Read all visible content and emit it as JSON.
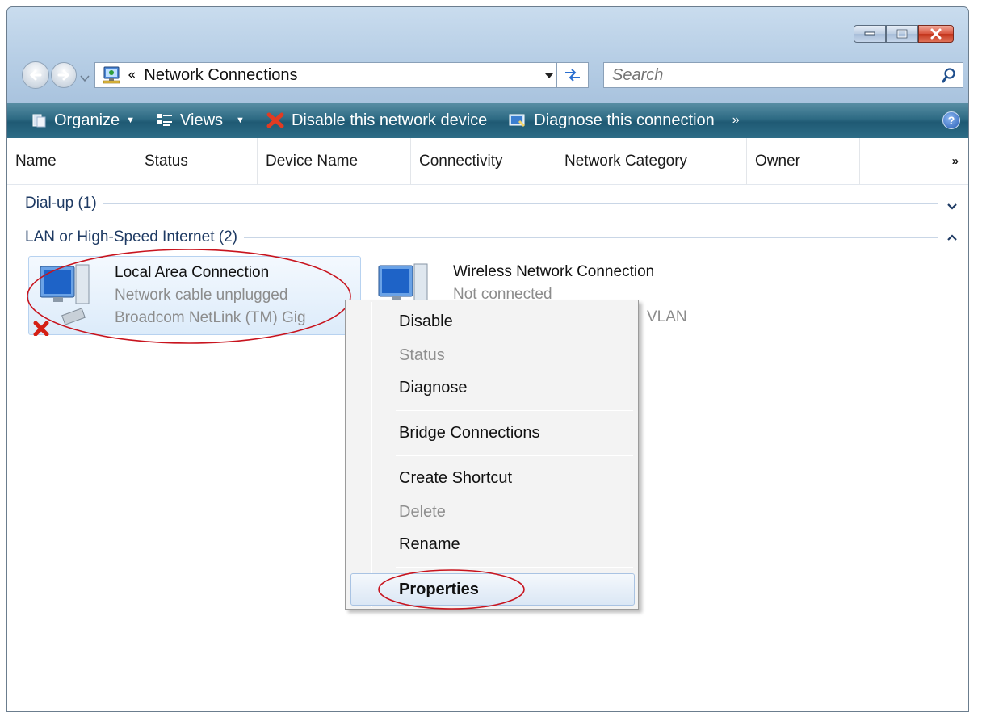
{
  "window": {
    "address": {
      "chevrons": "«",
      "path": "Network Connections"
    },
    "search": {
      "placeholder": "Search"
    }
  },
  "toolbar": {
    "organize": "Organize",
    "views": "Views",
    "disable": "Disable this network device",
    "diagnose": "Diagnose this connection",
    "more": "»",
    "help": "?"
  },
  "columns": {
    "name": "Name",
    "status": "Status",
    "device": "Device Name",
    "connectivity": "Connectivity",
    "category": "Network Category",
    "owner": "Owner",
    "more": "»"
  },
  "groups": {
    "dialup": "Dial-up (1)",
    "lan": "LAN or High-Speed Internet (2)"
  },
  "connections": {
    "lan": {
      "name": "Local Area Connection",
      "status": "Network cable unplugged",
      "device": "Broadcom NetLink (TM) Gig"
    },
    "wireless": {
      "name": "Wireless Network Connection",
      "status": "Not connected",
      "device": "VLAN"
    }
  },
  "context_menu": {
    "disable": "Disable",
    "status": "Status",
    "diagnose": "Diagnose",
    "bridge": "Bridge Connections",
    "shortcut": "Create Shortcut",
    "delete": "Delete",
    "rename": "Rename",
    "properties": "Properties"
  },
  "colors": {
    "command_bar": "#2e6b84",
    "annotation": "#c8141e"
  }
}
